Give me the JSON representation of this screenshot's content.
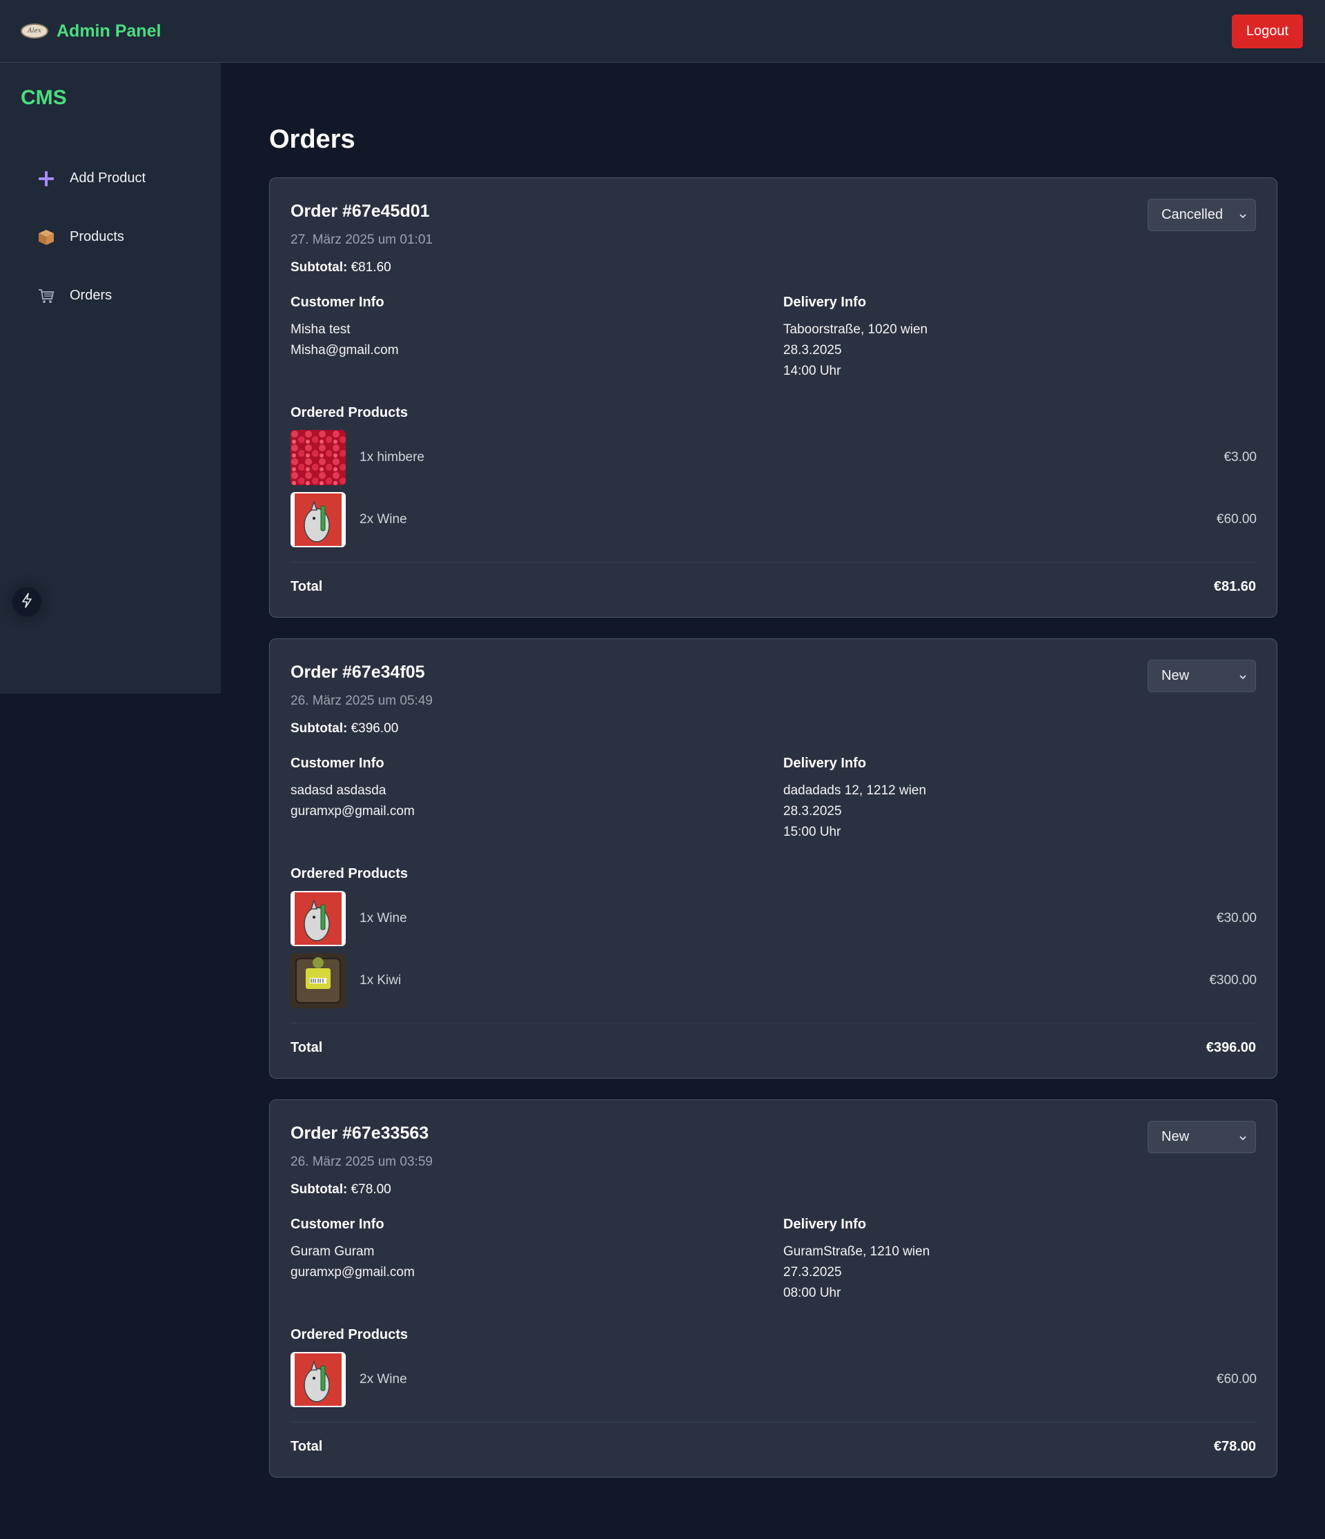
{
  "header": {
    "title": "Admin Panel",
    "logo_text": "Alex",
    "logout_label": "Logout"
  },
  "sidebar": {
    "title": "CMS",
    "items": [
      {
        "label": "Add Product",
        "icon": "plus-icon"
      },
      {
        "label": "Products",
        "icon": "package-icon"
      },
      {
        "label": "Orders",
        "icon": "cart-icon"
      }
    ]
  },
  "page": {
    "title": "Orders"
  },
  "labels": {
    "subtotal": "Subtotal:",
    "customer_info": "Customer Info",
    "delivery_info": "Delivery Info",
    "ordered_products": "Ordered Products",
    "total": "Total"
  },
  "orders": [
    {
      "title": "Order #67e45d01",
      "date": "27. März 2025 um 01:01",
      "subtotal": "€81.60",
      "status": "Cancelled",
      "customer": {
        "name": "Misha test",
        "email": "Misha@gmail.com"
      },
      "delivery": {
        "address": "Taboorstraße, 1020 wien",
        "date": "28.3.2025",
        "time": "14:00 Uhr"
      },
      "products": [
        {
          "name": "1x himbere",
          "price": "€3.00",
          "image": "raspberry-image"
        },
        {
          "name": "2x Wine",
          "price": "€60.00",
          "image": "wine-image"
        }
      ],
      "total": "€81.60"
    },
    {
      "title": "Order #67e34f05",
      "date": "26. März 2025 um 05:49",
      "subtotal": "€396.00",
      "status": "New",
      "customer": {
        "name": "sadasd asdasda",
        "email": "guramxp@gmail.com"
      },
      "delivery": {
        "address": "dadadads 12, 1212 wien",
        "date": "28.3.2025",
        "time": "15:00 Uhr"
      },
      "products": [
        {
          "name": "1x Wine",
          "price": "€30.00",
          "image": "wine-image"
        },
        {
          "name": "1x Kiwi",
          "price": "€300.00",
          "image": "kiwi-image"
        }
      ],
      "total": "€396.00"
    },
    {
      "title": "Order #67e33563",
      "date": "26. März 2025 um 03:59",
      "subtotal": "€78.00",
      "status": "New",
      "customer": {
        "name": "Guram Guram",
        "email": "guramxp@gmail.com"
      },
      "delivery": {
        "address": "GuramStraße, 1210 wien",
        "date": "27.3.2025",
        "time": "08:00 Uhr"
      },
      "products": [
        {
          "name": "2x Wine",
          "price": "€60.00",
          "image": "wine-image"
        }
      ],
      "total": "€78.00"
    }
  ],
  "colors": {
    "accent": "#4ade80",
    "logout": "#dc2626",
    "background": "#111827",
    "panel": "#1f2937",
    "card": "#2a3140"
  }
}
